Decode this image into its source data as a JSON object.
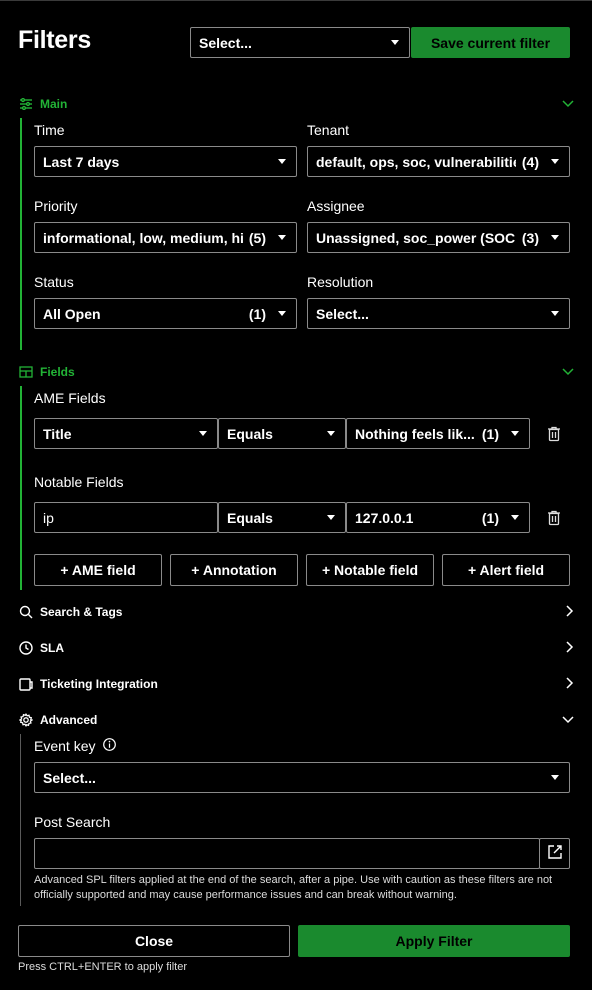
{
  "header": {
    "title": "Filters",
    "preset_select": "Select...",
    "save_button": "Save current filter"
  },
  "main": {
    "label": "Main",
    "time": {
      "label": "Time",
      "value": "Last 7 days"
    },
    "tenant": {
      "label": "Tenant",
      "value": "default, ops, soc, vulnerabilities",
      "count": "(4)"
    },
    "priority": {
      "label": "Priority",
      "value": "informational, low, medium, hi...",
      "count": "(5)"
    },
    "assignee": {
      "label": "Assignee",
      "value": "Unassigned, soc_power (SOC ...",
      "count": "(3)"
    },
    "status": {
      "label": "Status",
      "value": "All Open",
      "count": "(1)"
    },
    "resolution": {
      "label": "Resolution",
      "value": "Select..."
    }
  },
  "fields": {
    "label": "Fields",
    "ame": {
      "label": "AME Fields",
      "field": "Title",
      "operator": "Equals",
      "value": "Nothing feels lik...",
      "count": "(1)"
    },
    "notable": {
      "label": "Notable Fields",
      "field": "ip",
      "operator": "Equals",
      "value": "127.0.0.1",
      "count": "(1)"
    },
    "add_buttons": [
      "+ AME field",
      "+ Annotation",
      "+ Notable field",
      "+ Alert field"
    ]
  },
  "search_tags": {
    "label": "Search & Tags"
  },
  "sla": {
    "label": "SLA"
  },
  "ticketing": {
    "label": "Ticketing Integration"
  },
  "advanced": {
    "label": "Advanced",
    "event_key": {
      "label": "Event key",
      "value": "Select..."
    },
    "post_search": {
      "label": "Post Search",
      "value": "",
      "help": "Advanced SPL filters applied at the end of the search, after a pipe. Use with caution as these filters are not officially supported and may cause performance issues and can break without warning."
    }
  },
  "footer": {
    "close": "Close",
    "apply": "Apply Filter",
    "hint": "Press CTRL+ENTER to apply filter"
  },
  "colors": {
    "accent": "#22b336",
    "button_green": "#1a8a2e",
    "border": "#8a8a8a",
    "background": "#000000"
  }
}
